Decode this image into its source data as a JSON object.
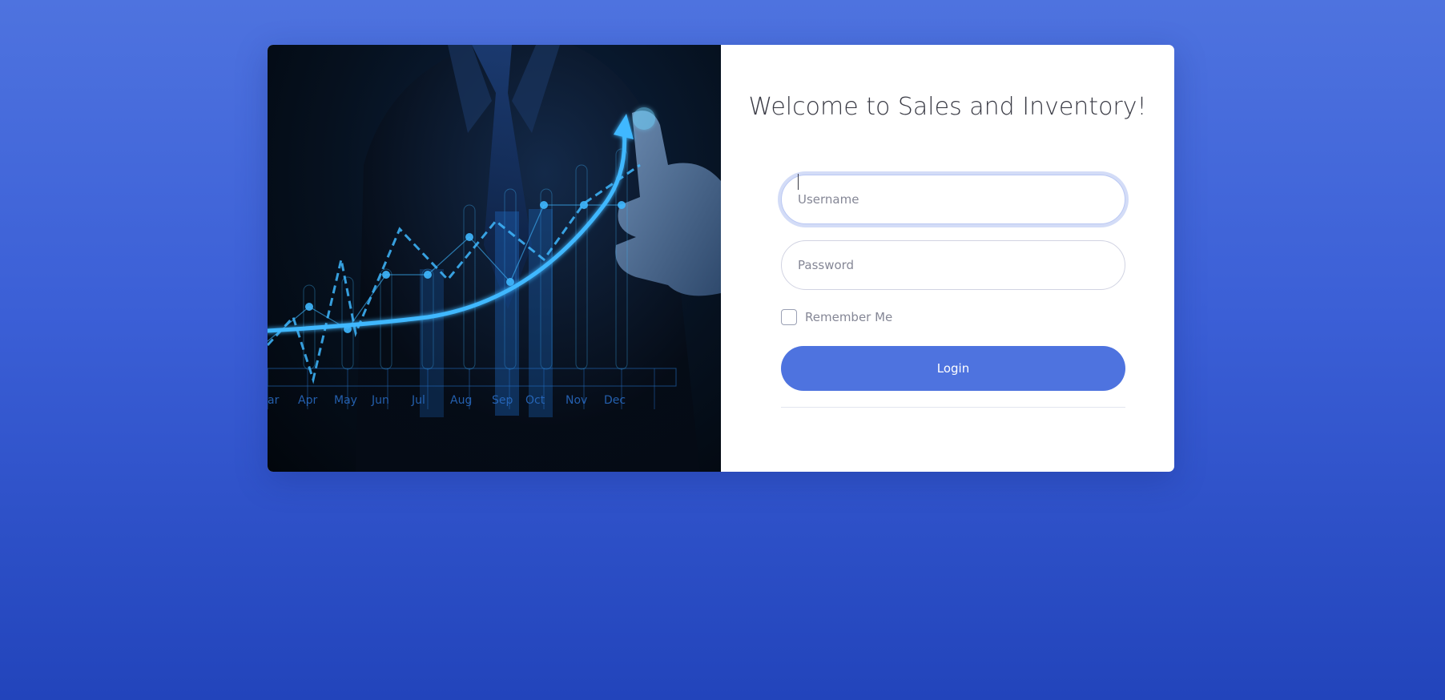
{
  "login": {
    "title": "Welcome to Sales and Inventory!",
    "username_placeholder": "Username",
    "password_placeholder": "Password",
    "remember_label": "Remember Me",
    "login_label": "Login"
  },
  "hero": {
    "month_labels": [
      "ar",
      "Apr",
      "May",
      "Jun",
      "Jul",
      "Aug",
      "Sep",
      "Oct",
      "Nov",
      "Dec"
    ]
  },
  "colors": {
    "background_top": "#4e73df",
    "background_bottom": "#2244bb",
    "primary": "#4e73df",
    "title_text": "#3a3b45",
    "hero_glow": "#3fb8ff"
  }
}
